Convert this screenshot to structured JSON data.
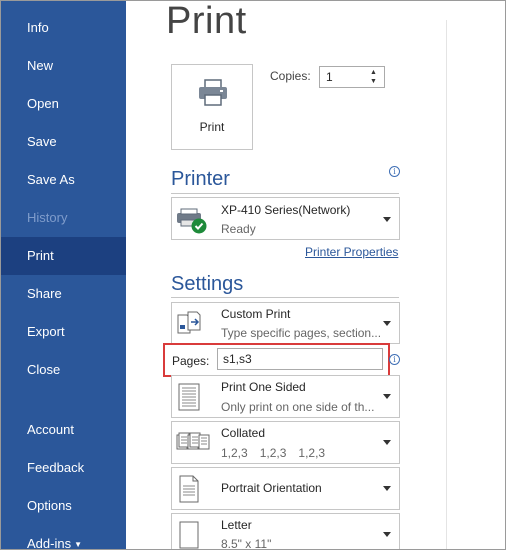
{
  "sidebar": {
    "items": [
      {
        "label": "Info"
      },
      {
        "label": "New"
      },
      {
        "label": "Open"
      },
      {
        "label": "Save"
      },
      {
        "label": "Save As"
      },
      {
        "label": "History",
        "disabled": true
      },
      {
        "label": "Print",
        "active": true
      },
      {
        "label": "Share"
      },
      {
        "label": "Export"
      },
      {
        "label": "Close"
      },
      {
        "label": "Account"
      },
      {
        "label": "Feedback"
      },
      {
        "label": "Options"
      },
      {
        "label": "Add-ins"
      }
    ],
    "colors": {
      "background": "#2b579a",
      "active": "#1c4080",
      "disabled_text": "#7f9ccb"
    }
  },
  "main": {
    "title": "Print",
    "print_button": {
      "label": "Print",
      "icon": "printer-icon"
    },
    "copies": {
      "label": "Copies:",
      "value": "1"
    },
    "printer": {
      "heading": "Printer",
      "name": "XP-410 Series(Network)",
      "status": "Ready",
      "properties_link": "Printer Properties",
      "icon": "printer-ready-icon"
    },
    "settings": {
      "heading": "Settings",
      "print_what": {
        "title": "Custom Print",
        "subtitle": "Type specific pages, section...",
        "icon": "custom-print-icon"
      },
      "pages": {
        "label": "Pages:",
        "value": "s1,s3"
      },
      "sides": {
        "title": "Print One Sided",
        "subtitle": "Only print on one side of th...",
        "icon": "one-sided-icon"
      },
      "collation": {
        "title": "Collated",
        "sequence": [
          "1,2,3",
          "1,2,3",
          "1,2,3"
        ],
        "icon": "collated-icon"
      },
      "orientation": {
        "title": "Portrait Orientation",
        "icon": "portrait-icon"
      },
      "paper": {
        "title": "Letter",
        "subtitle": "8.5\" x 11\"",
        "icon": "paper-icon"
      }
    },
    "colors": {
      "accent": "#2b579a",
      "highlight": "#d93b3b"
    }
  }
}
